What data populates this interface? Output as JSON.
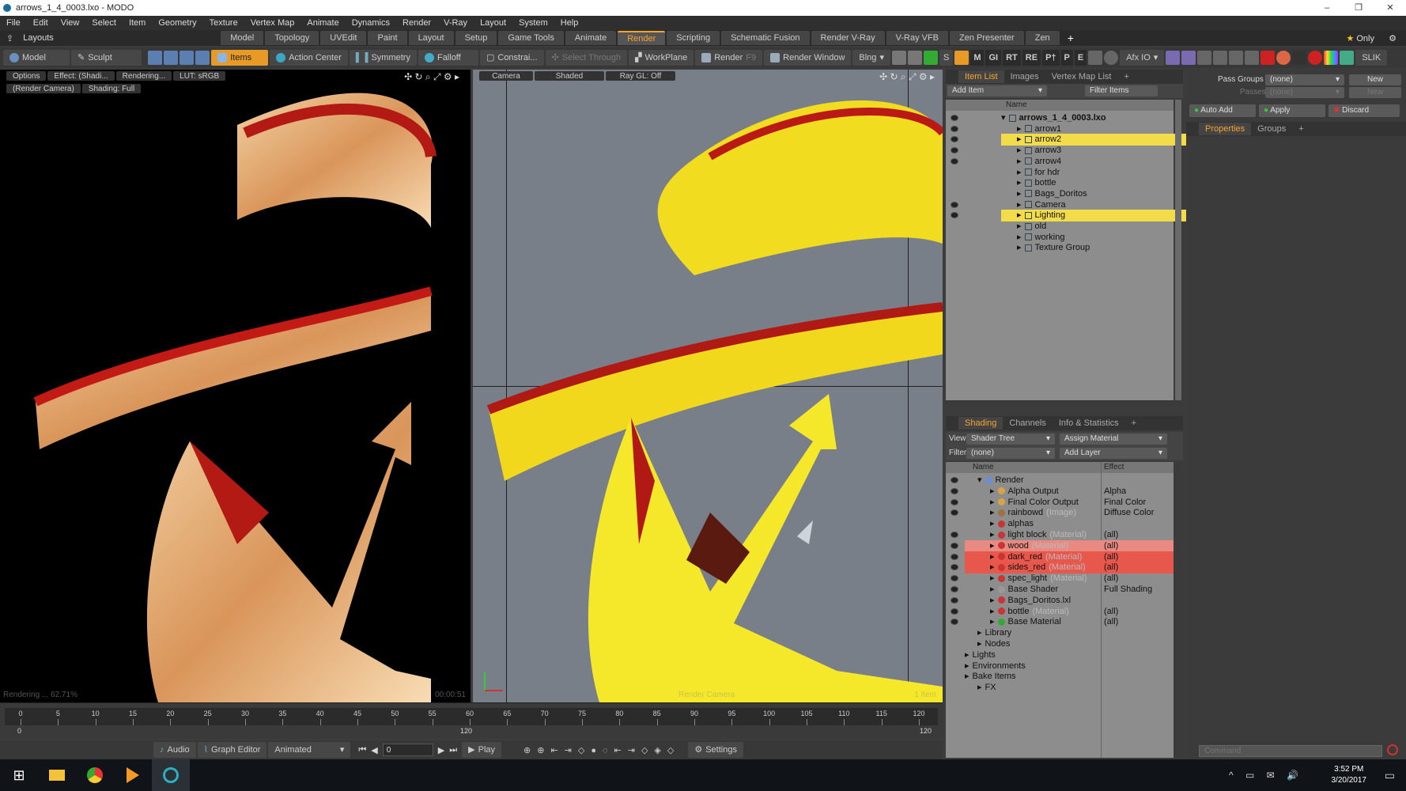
{
  "window": {
    "title": "arrows_1_4_0003.lxo - MODO",
    "min": "–",
    "max": "❐",
    "close": "✕"
  },
  "menu": [
    "File",
    "Edit",
    "View",
    "Select",
    "Item",
    "Geometry",
    "Texture",
    "Vertex Map",
    "Animate",
    "Dynamics",
    "Render",
    "V-Ray",
    "Layout",
    "System",
    "Help"
  ],
  "layouts": {
    "label": "Layouts",
    "tabs": [
      "Model",
      "Topology",
      "UVEdit",
      "Paint",
      "Layout",
      "Setup",
      "Game Tools",
      "Animate",
      "Render",
      "Scripting",
      "Schematic Fusion",
      "Render V-Ray",
      "V-Ray VFB",
      "Zen Presenter",
      "Zen"
    ],
    "active": "Render",
    "plus": "+",
    "only": "Only"
  },
  "toolbar": {
    "model": "Model",
    "sculpt": "Sculpt",
    "items": "Items",
    "action_center": "Action Center",
    "symmetry": "Symmetry",
    "falloff": "Falloff",
    "constrain": "Constrai...",
    "select_through": "Select Through",
    "workplane": "WorkPlane",
    "render": "Render",
    "render_hint": "F9",
    "render_window": "Render Window",
    "blng": "Blng",
    "letters": [
      "M",
      "GI",
      "RT",
      "RE",
      "P†",
      "P",
      "E"
    ],
    "afx": "Afx IO",
    "slik": "SLIK"
  },
  "left_viewport": {
    "options": "Options",
    "effect": "Effect: (Shadi...",
    "rendering": "Rendering...",
    "lut": "LUT: sRGB",
    "camera": "(Render Camera)",
    "shading": "Shading: Full",
    "status": "Rendering ... 62.71%",
    "timer": "00:00:51"
  },
  "right_viewport": {
    "camera": "Camera",
    "shaded": "Shaded",
    "raygl": "Ray GL: Off",
    "bottom_label": "Render Camera",
    "items_label": "1 Item"
  },
  "timeline": {
    "ticks": [
      0,
      5,
      10,
      15,
      20,
      25,
      30,
      35,
      40,
      45,
      50,
      55,
      60,
      65,
      70,
      75,
      80,
      85,
      90,
      95,
      100,
      105,
      110,
      115,
      120
    ],
    "start": "0",
    "end": "120",
    "end2": "120"
  },
  "playbar": {
    "audio": "Audio",
    "graph_editor": "Graph Editor",
    "animated": "Animated",
    "frame": "0",
    "play": "Play",
    "settings": "Settings"
  },
  "item_list": {
    "tabs": [
      "Item List",
      "Images",
      "Vertex Map List"
    ],
    "add_item": "Add Item",
    "filter_items": "Filter Items",
    "col_name": "Name",
    "rows": [
      {
        "name": "arrows_1_4_0003.lxo",
        "indent": 0,
        "bold": true,
        "hl": ""
      },
      {
        "name": "arrow1",
        "indent": 1,
        "hl": ""
      },
      {
        "name": "arrow2",
        "indent": 1,
        "hl": "y"
      },
      {
        "name": "arrow3",
        "indent": 1,
        "hl": ""
      },
      {
        "name": "arrow4",
        "indent": 1,
        "hl": ""
      },
      {
        "name": "for hdr",
        "indent": 1,
        "hl": ""
      },
      {
        "name": "bottle",
        "indent": 1,
        "hl": ""
      },
      {
        "name": "Bags_Doritos",
        "indent": 1,
        "hl": ""
      },
      {
        "name": "Camera",
        "indent": 1,
        "hl": ""
      },
      {
        "name": "Lighting",
        "indent": 1,
        "hl": "y"
      },
      {
        "name": "old",
        "indent": 1,
        "hl": ""
      },
      {
        "name": "working",
        "indent": 1,
        "hl": ""
      },
      {
        "name": "Texture Group",
        "indent": 1,
        "hl": ""
      }
    ]
  },
  "shading": {
    "tabs": [
      "Shading",
      "Channels",
      "Info & Statistics"
    ],
    "view_label": "View",
    "view_value": "Shader Tree",
    "assign_material": "Assign Material",
    "filter_label": "Filter",
    "filter_value": "(none)",
    "add_layer": "Add Layer",
    "col_name": "Name",
    "col_effect": "Effect",
    "rows": [
      {
        "name": "Render",
        "sub": "",
        "effect": "",
        "indent": 0,
        "hl": "",
        "color": "#6a8fd6"
      },
      {
        "name": "Alpha Output",
        "sub": "",
        "effect": "Alpha",
        "indent": 1,
        "hl": "",
        "color": "#d9a441"
      },
      {
        "name": "Final Color Output",
        "sub": "",
        "effect": "Final Color",
        "indent": 1,
        "hl": "",
        "color": "#d9a441"
      },
      {
        "name": "rainbowd",
        "sub": "(Image)",
        "effect": "Diffuse Color",
        "indent": 1,
        "hl": "",
        "color": "#a07040"
      },
      {
        "name": "alphas",
        "sub": "",
        "effect": "",
        "indent": 1,
        "hl": "",
        "color": "#c33"
      },
      {
        "name": "light block",
        "sub": "(Material)",
        "effect": "(all)",
        "indent": 1,
        "hl": "",
        "color": "#c33"
      },
      {
        "name": "wood",
        "sub": "(Material)",
        "effect": "(all)",
        "indent": 1,
        "hl": "pr",
        "color": "#c33"
      },
      {
        "name": "dark_red",
        "sub": "(Material)",
        "effect": "(all)",
        "indent": 1,
        "hl": "r",
        "color": "#c33"
      },
      {
        "name": "sides_red",
        "sub": "(Material)",
        "effect": "(all)",
        "indent": 1,
        "hl": "r",
        "color": "#c33"
      },
      {
        "name": "spec_light",
        "sub": "(Material)",
        "effect": "(all)",
        "indent": 1,
        "hl": "",
        "color": "#c33"
      },
      {
        "name": "Base Shader",
        "sub": "",
        "effect": "Full Shading",
        "indent": 1,
        "hl": "",
        "color": "#999"
      },
      {
        "name": "Bags_Doritos.lxl",
        "sub": "",
        "effect": "",
        "indent": 1,
        "hl": "",
        "color": "#c33"
      },
      {
        "name": "bottle",
        "sub": "(Material)",
        "effect": "(all)",
        "indent": 1,
        "hl": "",
        "color": "#c33"
      },
      {
        "name": "Base Material",
        "sub": "",
        "effect": "(all)",
        "indent": 1,
        "hl": "",
        "color": "#3a3"
      },
      {
        "name": "Library",
        "sub": "",
        "effect": "",
        "indent": 0,
        "hl": "",
        "color": ""
      },
      {
        "name": "Nodes",
        "sub": "",
        "effect": "",
        "indent": 0,
        "hl": "",
        "color": ""
      },
      {
        "name": "Lights",
        "sub": "",
        "effect": "",
        "indent": -1,
        "hl": "",
        "color": ""
      },
      {
        "name": "Environments",
        "sub": "",
        "effect": "",
        "indent": -1,
        "hl": "",
        "color": ""
      },
      {
        "name": "Bake Items",
        "sub": "",
        "effect": "",
        "indent": -1,
        "hl": "",
        "color": ""
      },
      {
        "name": "FX",
        "sub": "",
        "effect": "",
        "indent": 0,
        "hl": "",
        "color": ""
      }
    ]
  },
  "pass_groups": {
    "label": "Pass Groups",
    "value": "(none)",
    "passes_label": "Passes",
    "passes_value": "(none)",
    "new": "New",
    "new2": "New",
    "auto_add": "Auto Add",
    "apply": "Apply",
    "discard": "Discard",
    "tabs": [
      "Properties",
      "Groups"
    ]
  },
  "command": {
    "placeholder": "Command"
  },
  "taskbar": {
    "time": "3:52 PM",
    "date": "3/20/2017"
  },
  "colors": {
    "accent": "#f7a330",
    "select_yellow": "#f2dc4a",
    "select_red": "#e8574c"
  }
}
